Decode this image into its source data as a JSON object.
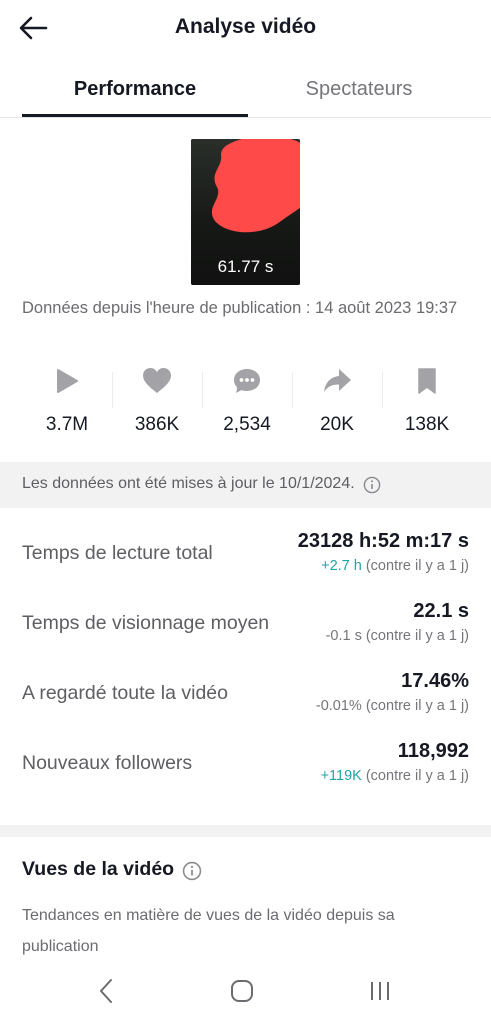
{
  "header": {
    "title": "Analyse vidéo"
  },
  "tabs": {
    "performance": "Performance",
    "spectateurs": "Spectateurs"
  },
  "video": {
    "duration": "61.77 s"
  },
  "published": "Données depuis l'heure de publication : 14 août 2023 19:37",
  "stats": {
    "views": "3.7M",
    "likes": "386K",
    "comments": "2,534",
    "shares": "20K",
    "saves": "138K"
  },
  "banner": {
    "text": "Les données ont été mises à jour le 10/1/2024."
  },
  "metrics": {
    "total_watch": {
      "label": "Temps de lecture total",
      "value": "23128 h:52 m:17 s",
      "delta": "+2.7 h",
      "compare": " (contre il y a 1 j)"
    },
    "avg_watch": {
      "label": "Temps de visionnage moyen",
      "value": "22.1 s",
      "delta": "-0.1 s",
      "compare": " (contre il y a 1 j)"
    },
    "full_watch": {
      "label": "A regardé toute la vidéo",
      "value": "17.46%",
      "delta": "-0.01%",
      "compare": " (contre il y a 1 j)"
    },
    "followers": {
      "label": "Nouveaux followers",
      "value": "118,992",
      "delta": "+119K",
      "compare": " (contre il y a 1 j)"
    }
  },
  "vues": {
    "title": "Vues de la vidéo",
    "description": "Tendances en matière de vues de la vidéo depuis sa publication"
  },
  "colors": {
    "positive": "#20a5a7",
    "redaction": "#ff4a4a"
  },
  "icons": {
    "back": "arrow-left-icon",
    "views": "play-icon",
    "likes": "heart-icon",
    "comments": "comment-icon",
    "shares": "share-icon",
    "saves": "bookmark-icon",
    "info": "info-icon",
    "nav_back": "chevron-left-icon",
    "nav_home": "home-icon",
    "nav_recents": "recents-icon"
  }
}
